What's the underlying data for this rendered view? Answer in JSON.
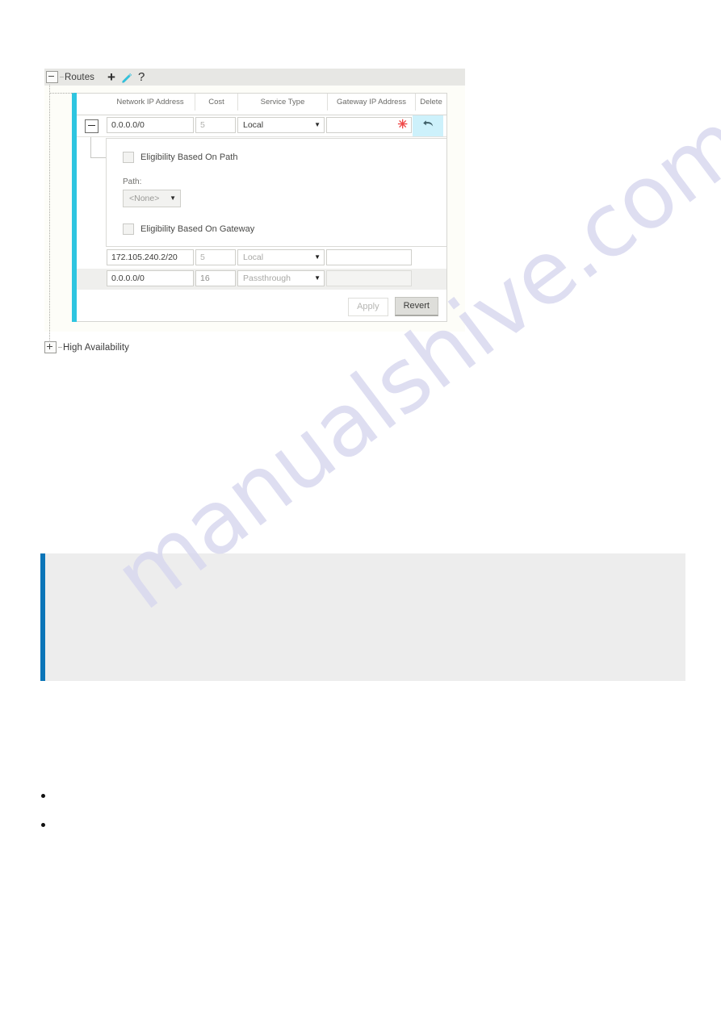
{
  "watermark": {
    "text": "manualshive.com"
  },
  "routes_panel": {
    "title": "Routes",
    "tools": {
      "add_label": "+",
      "add_icon": "plus-icon",
      "edit_icon": "pencil-icon",
      "help_label": "?",
      "help_icon": "question-mark-icon"
    },
    "accent_color": "#2ec5e0",
    "columns": [
      "Network IP Address",
      "Cost",
      "Service Type",
      "Gateway IP Address",
      "Delete"
    ],
    "rows": [
      {
        "network": "0.0.0.0/0",
        "cost": "5",
        "service_type": "Local",
        "gateway": "",
        "gateway_required_marker": "✳",
        "delete_icon": "undo-arrow-icon",
        "expanded": true
      },
      {
        "network": "172.105.240.2/20",
        "cost": "5",
        "service_type": "Local",
        "gateway": "",
        "delete_icon": "",
        "expanded": false
      },
      {
        "network": "0.0.0.0/0",
        "cost": "16",
        "service_type": "Passthrough",
        "gateway": "",
        "delete_icon": "",
        "expanded": false
      }
    ],
    "detail": {
      "eligibility_path_label": "Eligibility Based On Path",
      "path_field_label": "Path:",
      "path_value": "<None>",
      "eligibility_gateway_label": "Eligibility Based On Gateway"
    },
    "buttons": {
      "apply": "Apply",
      "revert": "Revert"
    }
  },
  "ha_node": {
    "title": "High Availability"
  },
  "note_callout": {
    "accent_color": "#0b75b8",
    "text": ""
  },
  "bullets": [
    {
      "text": ""
    },
    {
      "text": ""
    }
  ]
}
